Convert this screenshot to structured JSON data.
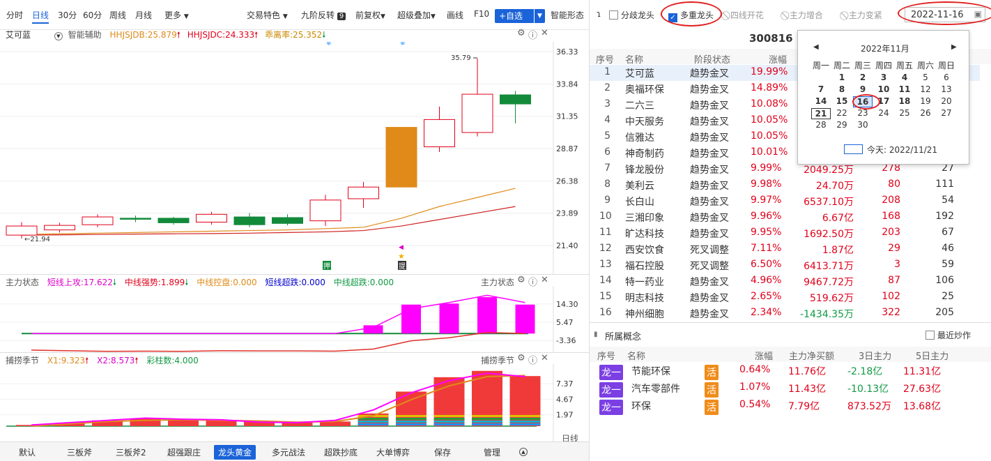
{
  "toolbar": {
    "periods": [
      "分时",
      "日线",
      "30分",
      "60分",
      "周线",
      "月线",
      "更多"
    ],
    "active_period": "日线",
    "tools": [
      "交易特色",
      "九阶反转",
      "前复权",
      "超级叠加",
      "画线",
      "F10"
    ],
    "nine_badge": "9",
    "self_select": "+自选",
    "smart_form": "智能形态"
  },
  "main_panel": {
    "stock_name": "艾可蓝",
    "assist": "智能辅助",
    "ind1": "HHJSJDB:25.879",
    "ind2": "HHJSJDC:24.333",
    "ind3": "乖离率:25.352",
    "price_axis": [
      "36.33",
      "33.84",
      "31.35",
      "28.87",
      "26.38",
      "23.89",
      "21.40"
    ],
    "high_label": "35.79",
    "low_label": "21.94",
    "marker_ya": "押",
    "marker_ti": "提",
    "colors": {
      "up": "#e0001a",
      "down": "#128a3a",
      "orange_bar": "#e08a1a"
    }
  },
  "chart_data": {
    "type": "candlestick",
    "candles": [
      {
        "o": 22.2,
        "c": 22.9,
        "h": 23.2,
        "l": 21.94
      },
      {
        "o": 22.6,
        "c": 22.95,
        "h": 23.15,
        "l": 22.4
      },
      {
        "o": 23.0,
        "c": 23.6,
        "h": 23.8,
        "l": 22.8
      },
      {
        "o": 23.5,
        "c": 23.45,
        "h": 23.7,
        "l": 23.2
      },
      {
        "o": 23.5,
        "c": 23.15,
        "h": 23.6,
        "l": 23.0
      },
      {
        "o": 23.2,
        "c": 23.8,
        "h": 24.0,
        "l": 23.0
      },
      {
        "o": 23.6,
        "c": 23.0,
        "h": 23.9,
        "l": 22.8
      },
      {
        "o": 23.55,
        "c": 23.1,
        "h": 23.8,
        "l": 22.95
      },
      {
        "o": 23.3,
        "c": 24.9,
        "h": 25.3,
        "l": 22.9
      },
      {
        "o": 25.0,
        "c": 25.9,
        "h": 26.3,
        "l": 24.3
      },
      {
        "o": 25.9,
        "c": 30.5,
        "h": 30.5,
        "l": 25.9
      },
      {
        "o": 29.0,
        "c": 31.1,
        "h": 32.1,
        "l": 28.6
      },
      {
        "o": 30.1,
        "c": 33.05,
        "h": 35.79,
        "l": 29.8
      },
      {
        "o": 33.0,
        "c": 32.3,
        "h": 33.3,
        "l": 30.8
      }
    ],
    "ma_orange": [
      22.25,
      22.3,
      22.35,
      22.4,
      22.45,
      22.5,
      22.55,
      22.6,
      22.7,
      22.8,
      23.5,
      24.4,
      25.1,
      25.8
    ],
    "ma_red": [
      22.2,
      22.22,
      22.25,
      22.28,
      22.3,
      22.32,
      22.35,
      22.4,
      22.45,
      22.55,
      22.9,
      23.4,
      23.9,
      24.4
    ],
    "ylim": [
      21.4,
      36.33
    ]
  },
  "ind1_panel": {
    "name": "主力状态",
    "vals": [
      "短线上攻:17.622",
      "中线强势:1.899",
      "中线控盘:0.000",
      "短线超跌:0.000",
      "中线超跌:0.000"
    ],
    "title_right": "主力状态",
    "axis": [
      "14.30",
      "5.47",
      "-3.36"
    ],
    "bars": [
      0,
      0,
      0,
      0,
      0,
      0,
      0,
      0,
      0,
      4.0,
      14.0,
      14.5,
      17.6,
      14.0
    ],
    "line_mag": [
      0,
      0,
      0,
      0,
      0,
      0,
      0,
      0,
      0,
      3.0,
      12,
      15,
      18.5,
      15
    ],
    "line_red": [
      -8,
      -8.3,
      -8.6,
      -8.5,
      -8.6,
      -8.3,
      -8.4,
      -8.4,
      -8.5,
      -7.5,
      -3.5,
      -2.0,
      0.5,
      0.0
    ],
    "ylim": [
      -8.0,
      21
    ]
  },
  "ind2_panel": {
    "name": "捕捞季节",
    "vals": [
      "X1:9.323",
      "X2:8.573",
      "彩柱数:4.000"
    ],
    "title_right": "捕捞季节",
    "axis": [
      "7.37",
      "4.67",
      "1.97"
    ],
    "bars": [
      0.2,
      0.5,
      1.0,
      1.3,
      1.2,
      1.0,
      0.8,
      0.6,
      0.8,
      2.2,
      6.0,
      8.5,
      9.6,
      8.7
    ],
    "line_mag": [
      0.2,
      0.6,
      1.0,
      1.4,
      1.2,
      1.1,
      0.7,
      0.6,
      1.0,
      2.8,
      5.8,
      7.9,
      9.2,
      8.6
    ],
    "line_org": [
      0.0,
      0.4,
      0.8,
      1.0,
      1.1,
      1.0,
      0.9,
      0.7,
      0.8,
      1.8,
      4.6,
      7.0,
      8.6,
      8.8
    ],
    "ylim": [
      0,
      10.3
    ],
    "period": "日线"
  },
  "bottom_tabs": [
    "默认",
    "三板斧",
    "三板斧2",
    "超强跟庄",
    "龙头黄金",
    "多元战法",
    "超跌抄底",
    "大单博弈",
    "保存",
    "管理"
  ],
  "active_tab": "龙头黄金",
  "right_top": {
    "options": [
      "分歧龙头",
      "多重龙头",
      "四线开花",
      "主力增合",
      "主力变紧"
    ],
    "date": "2022-11-16"
  },
  "code": "300816",
  "table": {
    "headers": [
      "序号",
      "名称",
      "阶段状态",
      "涨幅"
    ],
    "rows": [
      [
        "1",
        "艾可蓝",
        "趋势金叉",
        "19.99%",
        "",
        "",
        ""
      ],
      [
        "2",
        "奥福环保",
        "趋势金叉",
        "14.89%",
        "",
        "",
        ""
      ],
      [
        "3",
        "二六三",
        "趋势金叉",
        "10.08%",
        "",
        "",
        ""
      ],
      [
        "4",
        "中天服务",
        "趋势金叉",
        "10.05%",
        "",
        "",
        ""
      ],
      [
        "5",
        "信雅达",
        "趋势金叉",
        "10.05%",
        "",
        "",
        ""
      ],
      [
        "6",
        "神奇制药",
        "趋势金叉",
        "10.01%",
        "",
        "",
        ""
      ],
      [
        "7",
        "锋龙股份",
        "趋势金叉",
        "9.99%",
        "2049.25万",
        "278",
        "27"
      ],
      [
        "8",
        "美利云",
        "趋势金叉",
        "9.98%",
        "24.70万",
        "80",
        "111"
      ],
      [
        "9",
        "长白山",
        "趋势金叉",
        "9.97%",
        "6537.10万",
        "208",
        "54"
      ],
      [
        "10",
        "三湘印象",
        "趋势金叉",
        "9.96%",
        "6.67亿",
        "168",
        "192"
      ],
      [
        "11",
        "旷达科技",
        "趋势金叉",
        "9.95%",
        "1692.50万",
        "203",
        "67"
      ],
      [
        "12",
        "西安饮食",
        "死叉调整",
        "7.11%",
        "1.87亿",
        "29",
        "46"
      ],
      [
        "13",
        "福石控股",
        "死叉调整",
        "6.50%",
        "6413.71万",
        "3",
        "59"
      ],
      [
        "14",
        "特一药业",
        "趋势金叉",
        "4.96%",
        "9467.72万",
        "87",
        "106"
      ],
      [
        "15",
        "明志科技",
        "趋势金叉",
        "2.65%",
        "519.62万",
        "102",
        "25"
      ],
      [
        "16",
        "神州细胞",
        "趋势金叉",
        "2.34%",
        "-1434.35万",
        "322",
        "205"
      ]
    ]
  },
  "concepts": {
    "title": "所属概念",
    "recent": "最近炒作",
    "headers": [
      "序号",
      "名称",
      "涨幅",
      "主力净买额",
      "3日主力",
      "5日主力"
    ],
    "rows": [
      {
        "tag": "龙一",
        "name": "节能环保",
        "act": "活",
        "chg": "0.64%",
        "net": "11.76亿",
        "d3": "-2.18亿",
        "d5": "11.31亿"
      },
      {
        "tag": "龙一",
        "name": "汽车零部件",
        "act": "活",
        "chg": "1.07%",
        "net": "11.43亿",
        "d3": "-10.13亿",
        "d5": "27.63亿"
      },
      {
        "tag": "龙一",
        "name": "环保",
        "act": "活",
        "chg": "0.54%",
        "net": "7.79亿",
        "d3": "873.52万",
        "d5": "13.68亿"
      }
    ]
  },
  "datepicker": {
    "month": "2022年11月",
    "weekdays": [
      "周一",
      "周二",
      "周三",
      "周四",
      "周五",
      "周六",
      "周日"
    ],
    "rows": [
      [
        "",
        "1",
        "2",
        "3",
        "4",
        "5",
        "6"
      ],
      [
        "7",
        "8",
        "9",
        "10",
        "11",
        "12",
        "13"
      ],
      [
        "14",
        "15",
        "16",
        "17",
        "18",
        "19",
        "20"
      ],
      [
        "21",
        "22",
        "23",
        "24",
        "25",
        "26",
        "27"
      ],
      [
        "28",
        "29",
        "30",
        "",
        "",
        "",
        ""
      ]
    ],
    "selected": "16",
    "today_label": "今天: 2022/11/21"
  }
}
